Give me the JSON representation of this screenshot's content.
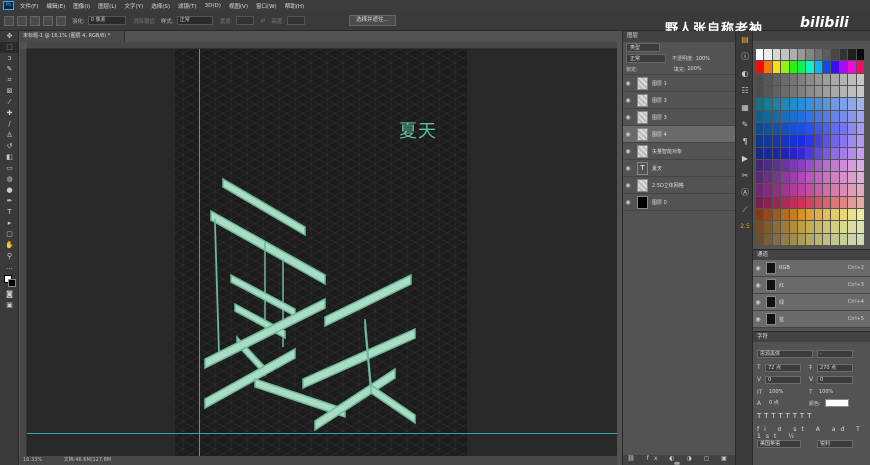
{
  "menubar": {
    "logo": "Ps",
    "items": [
      "文件(F)",
      "编辑(E)",
      "图像(I)",
      "图层(L)",
      "文字(Y)",
      "选择(S)",
      "滤镜(T)",
      "3D(D)",
      "视图(V)",
      "窗口(W)",
      "帮助(H)"
    ]
  },
  "options": {
    "feather_label": "羽化:",
    "feather_value": "0 像素",
    "antialias_label": "消除锯齿",
    "style_label": "样式:",
    "style_value": "正常",
    "width_label": "宽度:",
    "height_label": "高度:",
    "select_mask_button": "选择并遮住..."
  },
  "document": {
    "tab_title": "未标题-1 @ 16.1% (图层 4, RGB/8) *",
    "zoom": "16.33%",
    "doc_size": "文档:46.6M/127.8M",
    "canvas_text": "夏天",
    "big_glyph_a": "夏",
    "big_glyph_b": "天"
  },
  "layers_panel": {
    "tab": "图层",
    "filter_kind": "类型",
    "blend_mode": "正常",
    "opacity_label": "不透明度:",
    "opacity_value": "100%",
    "lock_label": "锁定:",
    "fill_label": "填充:",
    "fill_value": "100%",
    "layers": [
      {
        "name": "图层 1",
        "thumb": "checker",
        "selected": false
      },
      {
        "name": "图层 3",
        "thumb": "checker",
        "selected": false
      },
      {
        "name": "图层 3",
        "thumb": "checker",
        "selected": false
      },
      {
        "name": "图层 4",
        "thumb": "checker",
        "selected": true
      },
      {
        "name": "矢量智能对象",
        "thumb": "checker",
        "selected": false
      },
      {
        "name": "夏天",
        "thumb": "text",
        "selected": false
      },
      {
        "name": "2.5D立体网格",
        "thumb": "checker",
        "selected": false
      },
      {
        "name": "图层 0",
        "thumb": "dark",
        "selected": false
      }
    ]
  },
  "channels_panel": {
    "tab": "通道",
    "channels": [
      {
        "name": "RGB",
        "key": "Ctrl+2",
        "selected": true
      },
      {
        "name": "红",
        "key": "Ctrl+3",
        "selected": true
      },
      {
        "name": "绿",
        "key": "Ctrl+4",
        "selected": true
      },
      {
        "name": "蓝",
        "key": "Ctrl+5",
        "selected": true
      }
    ]
  },
  "character_panel": {
    "tab": "字符",
    "font_family": "思源黑体",
    "font_style": "-",
    "size": "72 点",
    "leading": "270 点",
    "kerning": "0",
    "tracking": "0",
    "vscale": "100%",
    "hscale": "100%",
    "baseline": "0 点",
    "color_label": "颜色:",
    "color": "#ffffff",
    "lang": "美国英语",
    "aa": "锐利"
  },
  "watermark": {
    "text": "野人张自称老衲",
    "brand": "bilibili"
  },
  "colors": {
    "accent": "#31a8ff",
    "glyph_face": "#a8dcc4",
    "glyph_side": "#6fb89a",
    "canvas_text": "#5fbfa5"
  }
}
